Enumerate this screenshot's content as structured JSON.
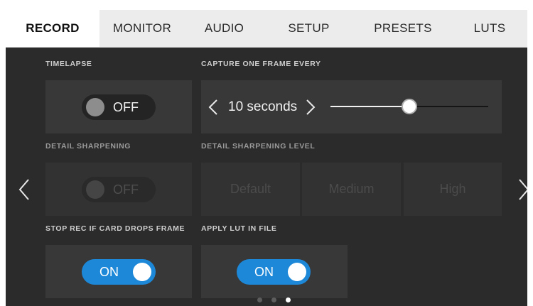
{
  "tabs": [
    {
      "label": "RECORD",
      "active": true
    },
    {
      "label": "MONITOR",
      "active": false
    },
    {
      "label": "AUDIO",
      "active": false
    },
    {
      "label": "SETUP",
      "active": false
    },
    {
      "label": "PRESETS",
      "active": false
    },
    {
      "label": "LUTS",
      "active": false
    }
  ],
  "timelapse": {
    "label": "TIMELAPSE",
    "state": "OFF"
  },
  "capture": {
    "label": "CAPTURE ONE FRAME EVERY",
    "value": "10 seconds",
    "slider_fraction": 0.5
  },
  "detail_sharpening": {
    "label": "DETAIL SHARPENING",
    "state": "OFF",
    "enabled": false
  },
  "detail_level": {
    "label": "DETAIL SHARPENING LEVEL",
    "options": [
      "Default",
      "Medium",
      "High"
    ],
    "enabled": false
  },
  "stop_rec": {
    "label": "STOP REC IF CARD DROPS FRAME",
    "state": "ON"
  },
  "apply_lut": {
    "label": "APPLY LUT IN FILE",
    "state": "ON"
  },
  "pagination": {
    "count": 3,
    "active_index": 2
  },
  "colors": {
    "accent": "#1e88d8",
    "panel": "#2b2b2b",
    "tab_bar": "#ececec"
  }
}
